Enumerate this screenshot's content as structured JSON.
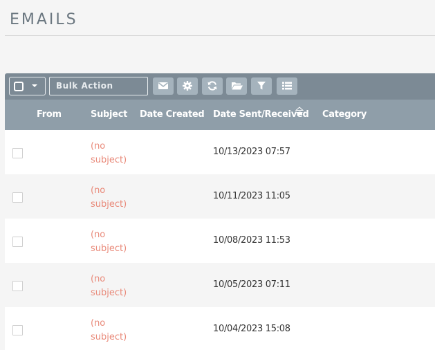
{
  "page": {
    "title": "EMAILS"
  },
  "toolbar": {
    "bulk_action_label": "Bulk Action",
    "buttons": [
      {
        "name": "compose-email-button",
        "icon": "envelope-icon"
      },
      {
        "name": "settings-button",
        "icon": "gear-icon"
      },
      {
        "name": "refresh-button",
        "icon": "refresh-icon"
      },
      {
        "name": "folders-button",
        "icon": "folder-open-icon"
      },
      {
        "name": "filter-button",
        "icon": "filter-icon"
      },
      {
        "name": "column-chooser-button",
        "icon": "list-icon"
      }
    ]
  },
  "table": {
    "columns": [
      "From",
      "Subject",
      "Date Created",
      "Date Sent/Received",
      "Category"
    ],
    "sort_column": "Date Sent/Received",
    "rows": [
      {
        "from": "",
        "subject": "(no subject)",
        "date_created": "",
        "date_sent": "10/13/2023 07:57",
        "category": ""
      },
      {
        "from": "",
        "subject": "(no subject)",
        "date_created": "",
        "date_sent": "10/11/2023 11:05",
        "category": ""
      },
      {
        "from": "",
        "subject": "(no subject)",
        "date_created": "",
        "date_sent": "10/08/2023 11:53",
        "category": ""
      },
      {
        "from": "",
        "subject": "(no subject)",
        "date_created": "",
        "date_sent": "10/05/2023 07:11",
        "category": ""
      },
      {
        "from": "",
        "subject": "(no subject)",
        "date_created": "",
        "date_sent": "10/04/2023 15:08",
        "category": ""
      }
    ]
  },
  "colors": {
    "toolbar_bg": "#7c8a95",
    "header_bg": "#8f9ea9",
    "button_bg": "#a5b3bd",
    "subject_link": "#e98a7a"
  }
}
